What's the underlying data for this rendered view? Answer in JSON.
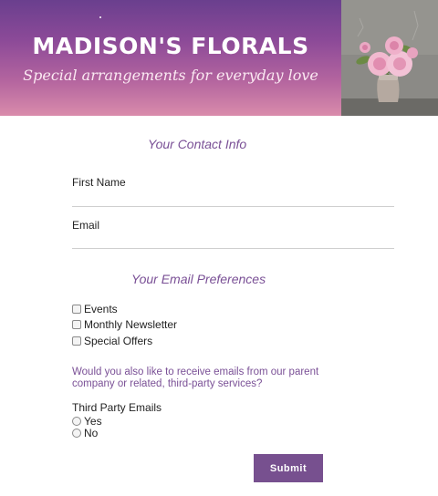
{
  "header": {
    "title": "MADISON'S FLORALS",
    "tagline": "Special arrangements for everyday love"
  },
  "contact": {
    "heading": "Your Contact Info",
    "first_name_label": "First Name",
    "first_name_value": "",
    "email_label": "Email",
    "email_value": ""
  },
  "preferences": {
    "heading": "Your Email Preferences",
    "options": [
      {
        "label": "Events",
        "checked": false
      },
      {
        "label": "Monthly Newsletter",
        "checked": false
      },
      {
        "label": "Special Offers",
        "checked": false
      }
    ]
  },
  "third_party": {
    "question": "Would you also like to receive emails from our parent company or related, third-party services?",
    "label": "Third Party Emails",
    "options": [
      {
        "label": "Yes",
        "selected": false
      },
      {
        "label": "No",
        "selected": false
      }
    ]
  },
  "submit": {
    "label": "Submit"
  },
  "colors": {
    "accent": "#77508f",
    "heading": "#7a5096"
  }
}
